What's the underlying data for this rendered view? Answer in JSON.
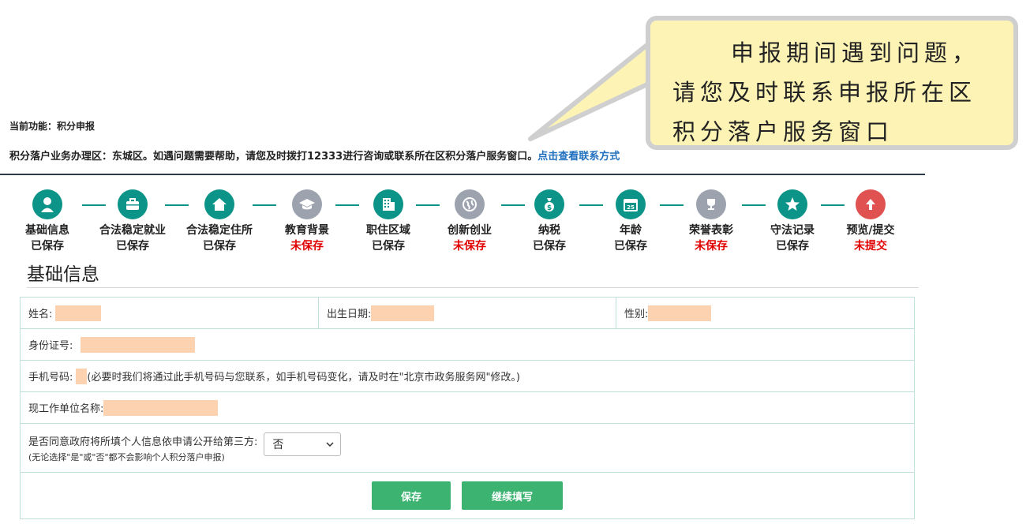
{
  "tooltip": {
    "line1": "申报期间遇到问题，",
    "line2": "请您及时联系申报所在区",
    "line3": "积分落户服务窗口"
  },
  "header": {
    "current_function": "当前功能：积分申报",
    "notice_text": "积分落户业务办理区：东城区。如遇问题需要帮助，请您及时拨打12333进行咨询或联系所在区积分落户服务窗口。",
    "notice_link": "点击查看联系方式"
  },
  "steps": [
    {
      "name": "基础信息",
      "status": "已保存",
      "icon": "person-icon",
      "saved": true
    },
    {
      "name": "合法稳定就业",
      "status": "已保存",
      "icon": "briefcase-icon",
      "saved": true
    },
    {
      "name": "合法稳定住所",
      "status": "已保存",
      "icon": "house-icon",
      "saved": true
    },
    {
      "name": "教育背景",
      "status": "未保存",
      "icon": "graduation-cap-icon",
      "saved": false
    },
    {
      "name": "职住区域",
      "status": "已保存",
      "icon": "building-icon",
      "saved": true
    },
    {
      "name": "创新创业",
      "status": "未保存",
      "icon": "globe-icon",
      "saved": false
    },
    {
      "name": "纳税",
      "status": "已保存",
      "icon": "money-bag-icon",
      "saved": true
    },
    {
      "name": "年龄",
      "status": "已保存",
      "icon": "calendar-icon",
      "saved": true
    },
    {
      "name": "荣誉表彰",
      "status": "未保存",
      "icon": "trophy-icon",
      "saved": false
    },
    {
      "name": "守法记录",
      "status": "已保存",
      "icon": "star-icon",
      "saved": true
    },
    {
      "name": "预览/提交",
      "status": "未提交",
      "icon": "upload-arrow-icon",
      "saved": false
    }
  ],
  "section_title": "基础信息",
  "form": {
    "name_label": "姓名:",
    "birth_label": "出生日期:",
    "gender_label": "性别:",
    "id_label": "身份证号:",
    "phone_label": "手机号码:",
    "phone_note": "(必要时我们将通过此手机号码与您联系，如手机号码变化，请及时在\"北京市政务服务网\"修改。)",
    "employer_label": "现工作单位名称:",
    "consent_label": "是否同意政府将所填个人信息依申请公开给第三方:",
    "consent_note": "(无论选择\"是\"或\"否\"都不会影响个人积分落户申报)",
    "consent_value": "否"
  },
  "buttons": {
    "save": "保存",
    "continue": "继续填写"
  }
}
